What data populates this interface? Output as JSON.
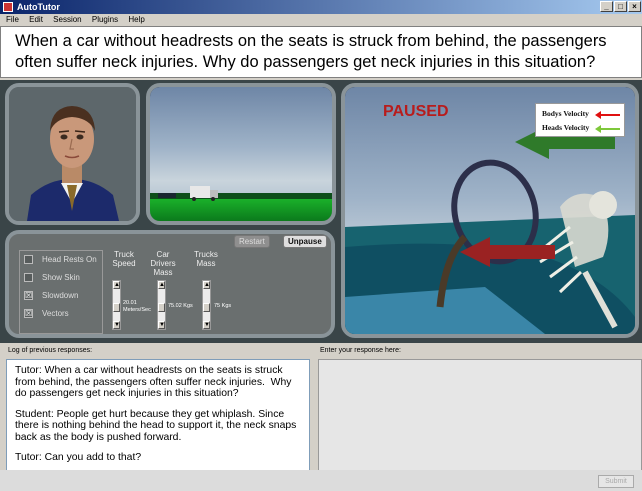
{
  "window": {
    "title": "AutoTutor",
    "minimize_glyph": "_",
    "maximize_glyph": "□",
    "close_glyph": "×"
  },
  "menu": {
    "items": [
      "File",
      "Edit",
      "Session",
      "Plugins",
      "Help"
    ]
  },
  "question": {
    "text": "When a car without headrests on the seats is struck from behind, the passengers often suffer neck injuries. Why do passengers get neck injuries in this situation?"
  },
  "simulation": {
    "controls": {
      "restart_label": "Restart",
      "unpause_label": "Unpause",
      "checkboxes": [
        {
          "label": "Head Rests On",
          "checked": false
        },
        {
          "label": "Show Skin",
          "checked": false
        },
        {
          "label": "Slowdown",
          "checked": true
        },
        {
          "label": "Vectors",
          "checked": true
        }
      ],
      "sliders": [
        {
          "header": "Truck Speed",
          "value": "20.01 Meters/Sec"
        },
        {
          "header": "Car Drivers Mass",
          "value": "75.02 Kgs"
        },
        {
          "header": "Trucks Mass",
          "value": "75 Kgs"
        }
      ],
      "check_glyph": "☒",
      "up_glyph": "▲",
      "down_glyph": "▼"
    },
    "animation": {
      "status": "PAUSED",
      "legend": [
        {
          "label": "Bodys Velocity",
          "color": "#e01010"
        },
        {
          "label": "Heads Velocity",
          "color": "#7ec83a"
        }
      ]
    }
  },
  "log": {
    "label": "Log of previous responses:",
    "entries": [
      "Tutor: When a car without headrests on the seats is struck from behind, the passengers often suffer neck injuries.  Why do passengers get neck injuries in this situation?",
      "Student: People get hurt because they get whiplash. Since there is nothing behind the head to support it, the neck snaps back as the body is pushed forward.",
      "Tutor: Can you add to that?"
    ]
  },
  "response": {
    "label": "Enter your response here:",
    "value": "",
    "submit_label": "Submit"
  }
}
